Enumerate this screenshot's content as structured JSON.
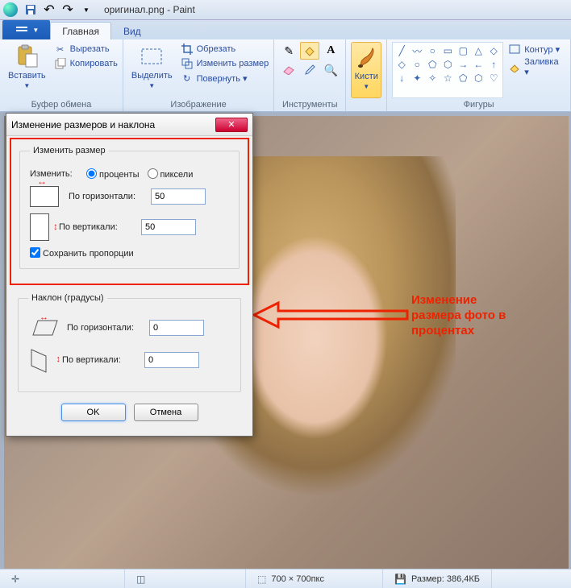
{
  "window_title": "оригинал.png - Paint",
  "tabs": {
    "file": "",
    "main": "Главная",
    "view": "Вид"
  },
  "ribbon": {
    "clipboard": {
      "paste": "Вставить",
      "cut": "Вырезать",
      "copy": "Копировать",
      "label": "Буфер обмена"
    },
    "image": {
      "select": "Выделить",
      "crop": "Обрезать",
      "resize": "Изменить размер",
      "rotate": "Повернуть ▾",
      "label": "Изображение"
    },
    "tools": {
      "label": "Инструменты"
    },
    "brushes": {
      "label": "Кисти"
    },
    "shapes": {
      "label": "Фигуры",
      "outline": "Контур ▾",
      "fill": "Заливка ▾"
    }
  },
  "dialog": {
    "title": "Изменение размеров и наклона",
    "resize_legend": "Изменить размер",
    "by_label": "Изменить:",
    "percent": "проценты",
    "pixels": "пиксели",
    "horizontal": "По горизонтали:",
    "vertical": "По вертикали:",
    "h_value": "50",
    "v_value": "50",
    "keep_aspect": "Сохранить пропорции",
    "skew_legend": "Наклон (градусы)",
    "skew_h": "0",
    "skew_v": "0",
    "ok": "OK",
    "cancel": "Отмена"
  },
  "annotation": "Изменение\nразмера фото в\nпроцентах",
  "status": {
    "dims": "700 × 700пкс",
    "size": "Размер: 386,4КБ"
  }
}
